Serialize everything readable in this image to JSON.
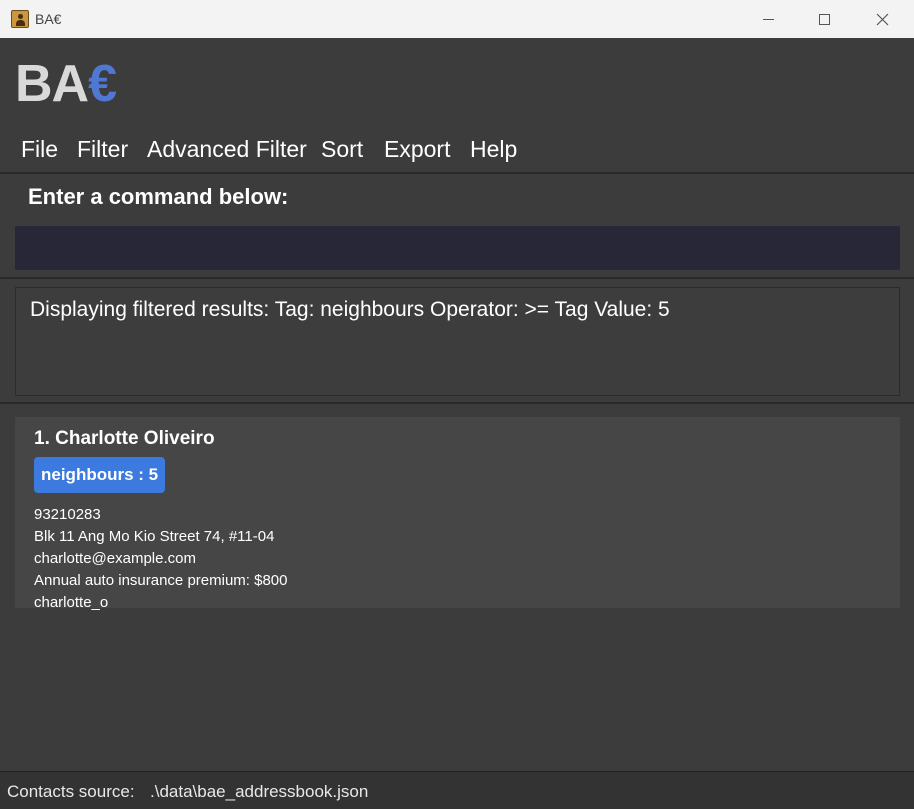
{
  "window": {
    "title": "BA€"
  },
  "logo": {
    "main": "BA",
    "accent": "€",
    "accent_color": "#4e78d2"
  },
  "menu": [
    "File",
    "Filter",
    "Advanced Filter",
    "Sort",
    "Export",
    "Help"
  ],
  "command": {
    "label": "Enter a command below:",
    "value": "",
    "placeholder": ""
  },
  "result": {
    "text": "Displaying filtered results: Tag: neighbours Operator: >= Tag Value: 5"
  },
  "contacts": [
    {
      "index_name": "1. Charlotte Oliveiro",
      "tag": "neighbours : 5",
      "tag_color": "#3d7ae0",
      "phone": "93210283",
      "address": "Blk 11 Ang Mo Kio Street 74, #11-04",
      "email": "charlotte@example.com",
      "note": "Annual auto insurance premium: $800",
      "handle": "charlotte_o"
    }
  ],
  "status": {
    "label": "Contacts source:",
    "value": ".\\data\\bae_addressbook.json"
  },
  "icons": {
    "app": "address-book-icon",
    "minimize": "minimize-icon",
    "maximize": "maximize-icon",
    "close": "close-icon"
  }
}
